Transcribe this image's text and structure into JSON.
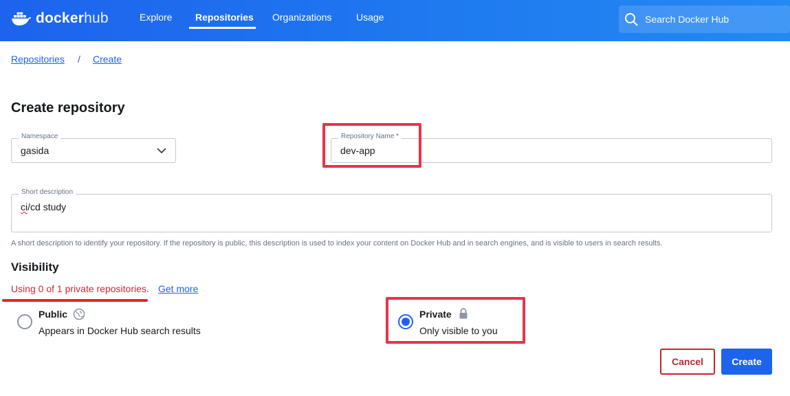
{
  "header": {
    "logo_text_bold": "docker",
    "logo_text_light": "hub",
    "nav": [
      {
        "label": "Explore"
      },
      {
        "label": "Repositories"
      },
      {
        "label": "Organizations"
      },
      {
        "label": "Usage"
      }
    ],
    "active_nav": "Repositories",
    "search_placeholder": "Search Docker Hub",
    "accent_color": "#1d63ed"
  },
  "breadcrumb": {
    "items": [
      "Repositories",
      "Create"
    ],
    "separator": "/"
  },
  "form": {
    "title": "Create repository",
    "namespace_label": "Namespace",
    "namespace_value": "gasida",
    "repo_name_label": "Repository Name *",
    "repo_name_value": "dev-app",
    "short_desc_label": "Short description",
    "short_desc_value_misspelled": "ci",
    "short_desc_value_rest": "/cd study",
    "short_desc_helper": "A short description to identify your repository. If the repository is public, this description is used to index your content on Docker Hub and in search engines, and is visible to users in search results."
  },
  "visibility": {
    "title": "Visibility",
    "usage_text": "Using 0 of 1 private repositories.",
    "get_more_label": "Get more",
    "options": [
      {
        "title": "Public",
        "description": "Appears in Docker Hub search results",
        "icon": "globe-icon",
        "selected": false
      },
      {
        "title": "Private",
        "description": "Only visible to you",
        "icon": "lock-icon",
        "selected": true
      }
    ]
  },
  "actions": {
    "cancel_label": "Cancel",
    "create_label": "Create"
  },
  "annotation_color": "#e8334a"
}
